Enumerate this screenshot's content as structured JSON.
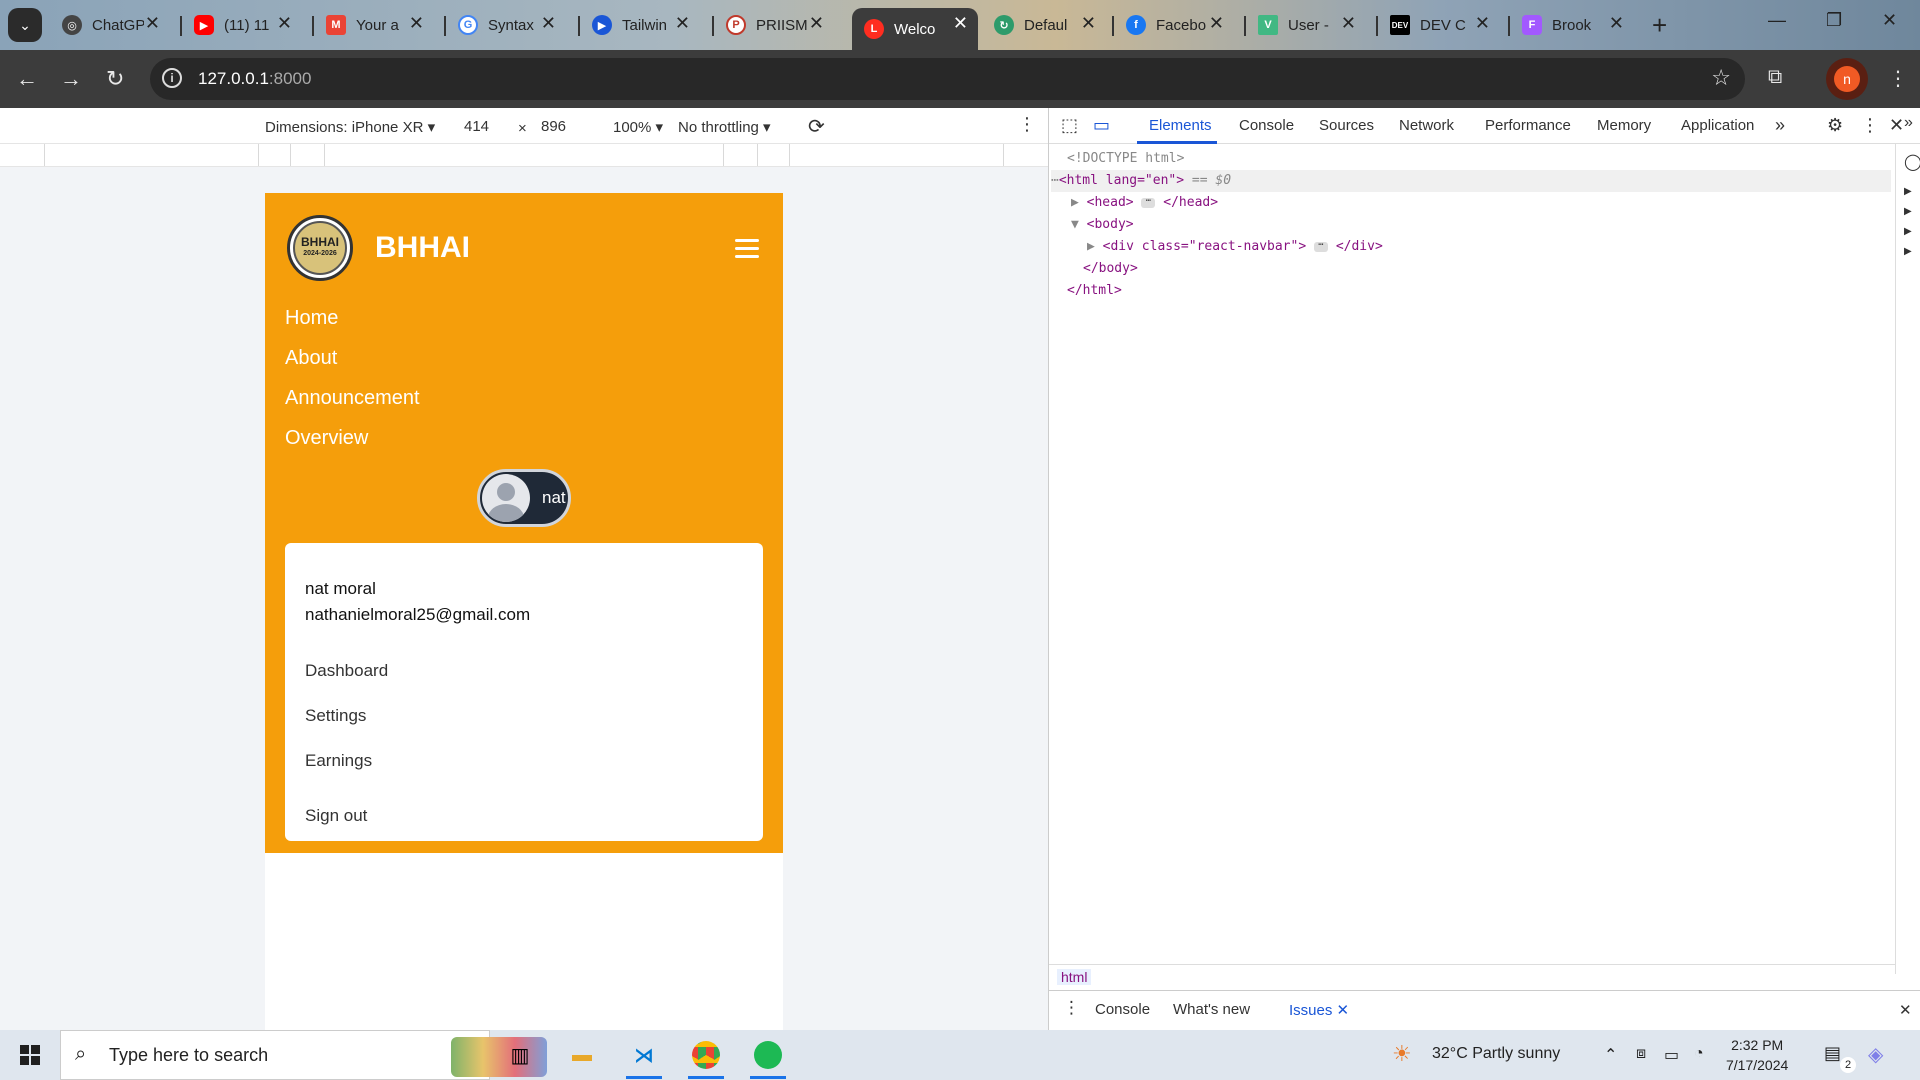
{
  "browser": {
    "tabs": [
      {
        "title": "ChatGPT",
        "favicon": "chatgpt-icon",
        "color": "#444444"
      },
      {
        "title": "(11) 11",
        "favicon": "youtube-icon",
        "color": "#ff0000"
      },
      {
        "title": "Your a",
        "favicon": "gmail-icon",
        "color": "#ea4335"
      },
      {
        "title": "Syntax",
        "favicon": "google-icon",
        "color": "#4285f4"
      },
      {
        "title": "Tailwin",
        "favicon": "tailwind-icon",
        "color": "#1a56d6"
      },
      {
        "title": "PRIISM",
        "favicon": "priism-icon",
        "color": "#c0392b"
      },
      {
        "title": "Welco",
        "favicon": "laravel-icon",
        "color": "#ff2d20"
      },
      {
        "title": "Defaul",
        "favicon": "default-icon",
        "color": "#2e9b6b"
      },
      {
        "title": "Facebo",
        "favicon": "facebook-icon",
        "color": "#1877f2"
      },
      {
        "title": "User -",
        "favicon": "vue-icon",
        "color": "#41b883"
      },
      {
        "title": "DEV C",
        "favicon": "dev-icon",
        "color": "#000000"
      },
      {
        "title": "Brook",
        "favicon": "figma-icon",
        "color": "#a259ff"
      }
    ],
    "url_host": "127.0.0.1",
    "url_port": ":8000",
    "profile_initial": "n"
  },
  "device_toolbar": {
    "dimensions": "Dimensions: iPhone XR",
    "width": "414",
    "height": "896",
    "times": "×",
    "zoom": "100%",
    "throttling": "No throttling"
  },
  "site": {
    "brand": "BHHAI",
    "logo_text": "BHHAI",
    "logo_sub": "2024-2026",
    "nav_links": [
      "Home",
      "About",
      "Announcement",
      "Overview"
    ],
    "user_short": "nat",
    "dropdown": {
      "name": "nat moral",
      "email": "nathanielmoral25@gmail.com",
      "items": [
        "Dashboard",
        "Settings",
        "Earnings"
      ],
      "signout": "Sign out"
    },
    "accent": "#f59e0b"
  },
  "devtools": {
    "tabs": [
      "Elements",
      "Console",
      "Sources",
      "Network",
      "Performance",
      "Memory",
      "Application"
    ],
    "code": {
      "doctype": "<!DOCTYPE html>",
      "html_open": "<html lang=\"en\">",
      "selected_marker": "== $0",
      "head": "<head>",
      "head_close": "</head>",
      "body_open": "<body>",
      "div_open": "<div class=\"react-navbar\">",
      "div_close": "</div>",
      "body_close": "</body>",
      "html_close": "</html>"
    },
    "breadcrumb": "html",
    "drawer_tabs": [
      "Console",
      "What's new",
      "Issues"
    ]
  },
  "taskbar": {
    "search_placeholder": "Type here to search",
    "weather": "32°C  Partly sunny",
    "time": "2:32 PM",
    "date": "7/17/2024",
    "notification_count": "2"
  }
}
